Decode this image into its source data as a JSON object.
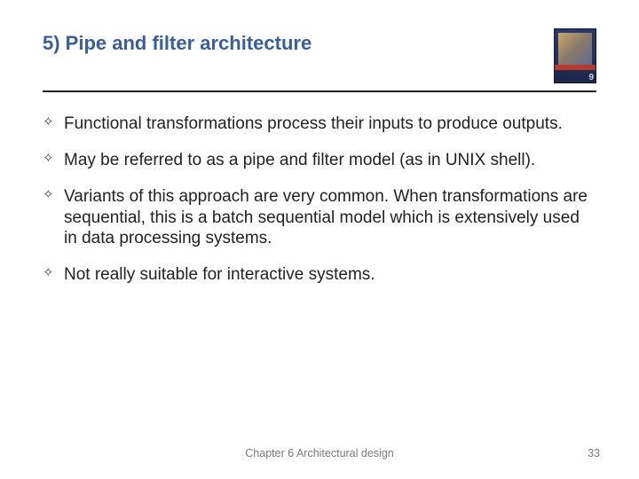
{
  "header": {
    "title": "5) Pipe and filter architecture",
    "book_edition": "9"
  },
  "bullets": [
    "Functional transformations process their inputs to produce outputs.",
    "May be referred to as a pipe and filter model (as in UNIX shell).",
    "Variants of this approach are very common. When transformations are sequential, this is a batch sequential model which is extensively used in data processing systems.",
    "Not really suitable for interactive systems."
  ],
  "footer": {
    "chapter": "Chapter 6 Architectural design",
    "page": "33"
  }
}
